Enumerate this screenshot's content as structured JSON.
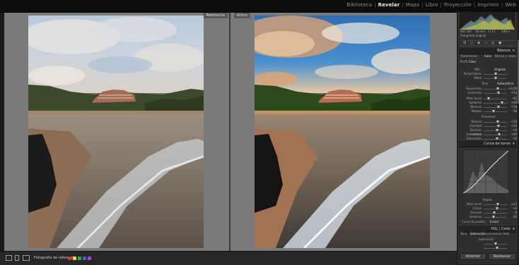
{
  "modules": [
    {
      "label": "Biblioteca",
      "active": false
    },
    {
      "label": "Revelar",
      "active": true
    },
    {
      "label": "Mapa",
      "active": false
    },
    {
      "label": "Libro",
      "active": false
    },
    {
      "label": "Proyección",
      "active": false
    },
    {
      "label": "Imprimir",
      "active": false
    },
    {
      "label": "Web",
      "active": false
    }
  ],
  "view": {
    "reference_label": "Referencia",
    "active_label": "Activo"
  },
  "toolbar": {
    "reference_view_label": "Fotografía de referencia :"
  },
  "panel": {
    "histogram": {
      "original_photo": "Fotografía original",
      "exif": [
        "ISO 100",
        "18 mm",
        "f / 11",
        "1/80 s"
      ]
    },
    "basic": {
      "title": "Básicos",
      "treatment_label": "Tratamiento :",
      "treatment_options": [
        "Color",
        "Blanco y negro"
      ],
      "profile_label": "Perfil :",
      "profile_value": "Color",
      "wb_label": "WB :",
      "wb_value": "Original",
      "tone_label": "Tono",
      "tone_auto": "Automático",
      "presence_label": "Presencia",
      "sliders": [
        {
          "label": "Temperatura",
          "value": ""
        },
        {
          "label": "Matiz",
          "value": ""
        },
        {
          "label": "Exposición",
          "value": "+0,20"
        },
        {
          "label": "Contraste",
          "value": "+14"
        },
        {
          "label": "Altas luces",
          "value": "-62"
        },
        {
          "label": "Sombras",
          "value": "+48"
        },
        {
          "label": "Blancos",
          "value": "+18"
        },
        {
          "label": "Negros",
          "value": "-16"
        },
        {
          "label": "Textura",
          "value": "+12"
        },
        {
          "label": "Claridad",
          "value": "+18"
        },
        {
          "label": "Eliminar neblina",
          "value": "+8"
        },
        {
          "label": "Intensidad",
          "value": "+20"
        },
        {
          "label": "Saturación",
          "value": "+6"
        }
      ]
    },
    "tone_curve": {
      "title": "Curva de tonos",
      "region_label": "Región",
      "sliders": [
        {
          "label": "Altas luces",
          "value": "+12"
        },
        {
          "label": "Claros",
          "value": "+8"
        },
        {
          "label": "Oscuros",
          "value": "-6"
        },
        {
          "label": "Sombras",
          "value": "-10"
        }
      ],
      "point_curve_label": "Curva de puntos :",
      "point_curve_value": "Lineal"
    },
    "hsl": {
      "title": "HSL / Color",
      "tabs": [
        "Tono",
        "Saturación",
        "Luminancia",
        "Todo"
      ],
      "saturation_label": "Saturación"
    },
    "footer": {
      "previous": "Anterior",
      "reset": "Restaurar"
    }
  },
  "colors": {
    "accent_active": "#e8e8e8",
    "panel_bg": "#2e2e2e",
    "stage_bg": "#7a7a7a"
  }
}
